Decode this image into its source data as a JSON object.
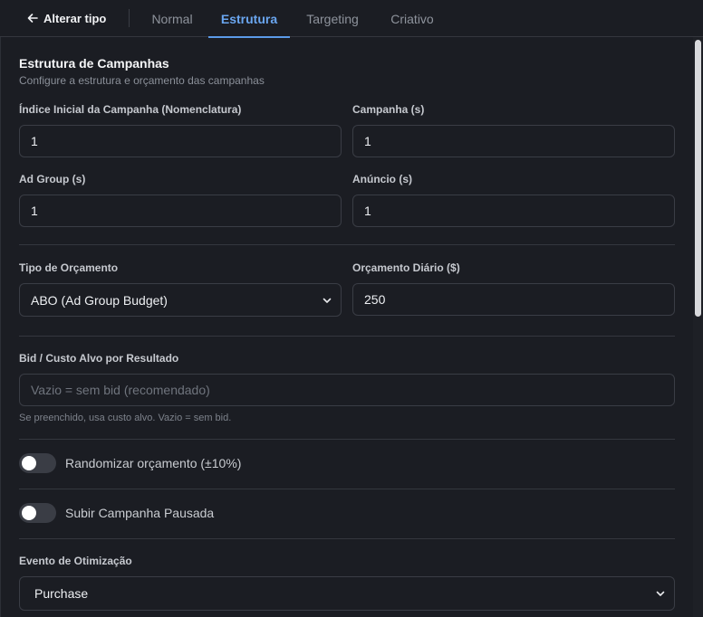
{
  "header": {
    "back_label": "Alterar tipo",
    "tabs": [
      {
        "label": "Normal",
        "active": false
      },
      {
        "label": "Estrutura",
        "active": true
      },
      {
        "label": "Targeting",
        "active": false
      },
      {
        "label": "Criativo",
        "active": false
      }
    ]
  },
  "section": {
    "title": "Estrutura de Campanhas",
    "subtitle": "Configure a estrutura e orçamento das campanhas"
  },
  "fields": {
    "start_index": {
      "label": "Índice Inicial da Campanha (Nomenclatura)",
      "value": "1"
    },
    "campaigns": {
      "label": "Campanha (s)",
      "value": "1"
    },
    "ad_groups": {
      "label": "Ad Group (s)",
      "value": "1"
    },
    "ads": {
      "label": "Anúncio (s)",
      "value": "1"
    },
    "budget_type": {
      "label": "Tipo de Orçamento",
      "value": "ABO (Ad Group Budget)"
    },
    "daily_budget": {
      "label": "Orçamento Diário ($)",
      "value": "250"
    },
    "bid": {
      "label": "Bid / Custo Alvo por Resultado",
      "placeholder": "Vazio = sem bid (recomendado)",
      "hint": "Se preenchido, usa custo alvo. Vazio = sem bid."
    },
    "optimization_event": {
      "label": "Evento de Otimização",
      "value": "Purchase"
    }
  },
  "toggles": {
    "randomize": {
      "label": "Randomizar orçamento (±10%)",
      "on": false
    },
    "paused": {
      "label": "Subir Campanha Pausada",
      "on": false
    }
  },
  "colors": {
    "background": "#1b1d23",
    "accent": "#5b9ae8",
    "border": "#3a3d45"
  }
}
